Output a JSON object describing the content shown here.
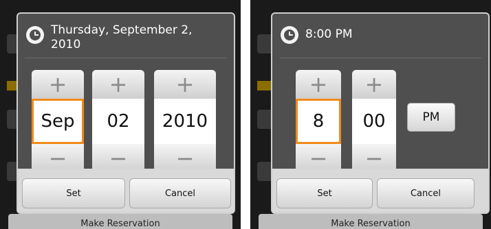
{
  "left": {
    "title": "Thursday, September 2, 2010",
    "pickers": [
      {
        "value": "Sep",
        "plus": "+",
        "minus": "−"
      },
      {
        "value": "02",
        "plus": "+",
        "minus": "−"
      },
      {
        "value": "2010",
        "plus": "+",
        "minus": "−"
      }
    ],
    "buttons": {
      "set": "Set",
      "cancel": "Cancel"
    },
    "background": {
      "make_reservation": "Make Reservation"
    }
  },
  "right": {
    "title": "8:00 PM",
    "pickers": [
      {
        "value": "8",
        "plus": "+",
        "minus": "−"
      },
      {
        "value": "00",
        "plus": "+",
        "minus": "−"
      }
    ],
    "ampm": "PM",
    "buttons": {
      "set": "Set",
      "cancel": "Cancel"
    },
    "background": {
      "make_reservation": "Make Reservation"
    }
  },
  "colors": {
    "focus": "#f28a1a",
    "dialog_bg": "#4f4f4f"
  },
  "icons": {
    "title_icon": "clock-icon"
  }
}
